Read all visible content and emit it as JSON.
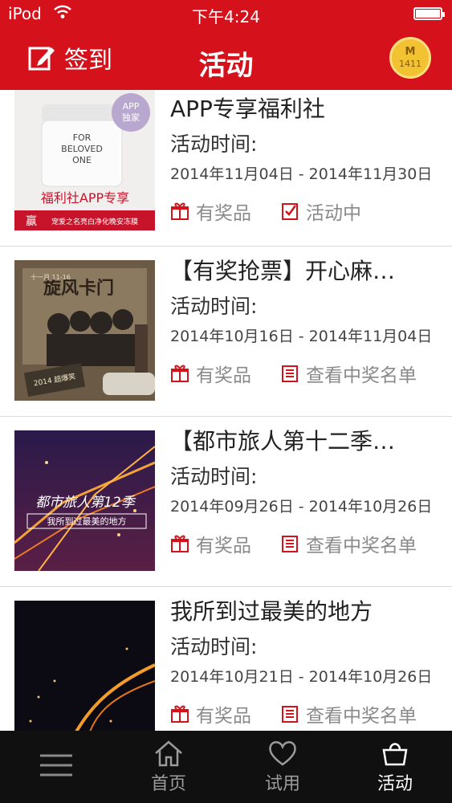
{
  "status_bar": {
    "carrier": "iPod",
    "time": "下午4:24"
  },
  "header": {
    "signin_label": "签到",
    "title": "活动",
    "badge_letter": "M",
    "badge_number": "1411"
  },
  "activities": [
    {
      "title": "APP专享福利社",
      "time_label": "活动时间:",
      "date_range": "2014年11月04日 - 2014年11月30日",
      "prize_label": "有奖品",
      "status_label": "活动中",
      "thumb_text": {
        "corner": "APP",
        "corner2": "独家",
        "brand1": "FOR",
        "brand2": "BELOVED",
        "brand3": "ONE",
        "caption": "福利社APP专享",
        "footer": "宠爱之名亮白净化晚安冻膜",
        "side": "赢"
      }
    },
    {
      "title": "【有奖抢票】开心麻…",
      "time_label": "活动时间:",
      "date_range": "2014年10月16日 - 2014年11月04日",
      "prize_label": "有奖品",
      "status_label": "查看中奖名单",
      "thumb_text": {
        "title": "旋风卡门",
        "date": "十一月 11-16",
        "sub": "2014 超爆笑"
      }
    },
    {
      "title": "【都市旅人第十二季…",
      "time_label": "活动时间:",
      "date_range": "2014年09月26日 - 2014年10月26日",
      "prize_label": "有奖品",
      "status_label": "查看中奖名单",
      "thumb_text": {
        "title": "都市旅人第12季",
        "sub": "我所到过最美的地方"
      }
    },
    {
      "title": "我所到过最美的地方",
      "time_label": "活动时间:",
      "date_range": "2014年10月21日 - 2014年10月26日",
      "prize_label": "有奖品",
      "status_label": "查看中奖名单"
    }
  ],
  "tabbar": {
    "tabs": [
      {
        "label": ""
      },
      {
        "label": "首页"
      },
      {
        "label": "试用"
      },
      {
        "label": "活动"
      }
    ]
  },
  "colors": {
    "brand_red": "#d5121b",
    "icon_red": "#d5121b",
    "tabbar_bg": "#101010"
  }
}
